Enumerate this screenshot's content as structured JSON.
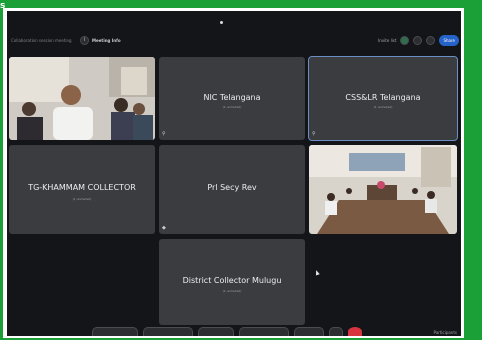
{
  "overlay": {
    "corner_text": "s"
  },
  "topbar": {
    "meeting_name": "Collaboration session meeting",
    "meeting_info_label": "Meeting Info",
    "right_label": "Invite list",
    "share_label": "Share"
  },
  "tiles": [
    {
      "name": "NIC Telangana",
      "sub": "(1 unmuted)",
      "active": false
    },
    {
      "name": "CSS&LR Telangana",
      "sub": "(1 unmuted)",
      "active": true
    },
    {
      "name": "TG-KHAMMAM COLLECTOR",
      "sub": "(1 unmuted)",
      "active": false
    },
    {
      "name": "Prl Secy Rev",
      "sub": "",
      "active": false
    },
    {
      "name": "District Collector Mulugu",
      "sub": "(1 unmuted)",
      "active": false
    }
  ],
  "bottombar": {
    "right_label": "Participants"
  },
  "colors": {
    "border_green": "#1aa037",
    "screen_bg": "#141518",
    "tile_bg": "#3a3c40",
    "accent_blue": "#2563c9",
    "end_red": "#d8343f"
  }
}
